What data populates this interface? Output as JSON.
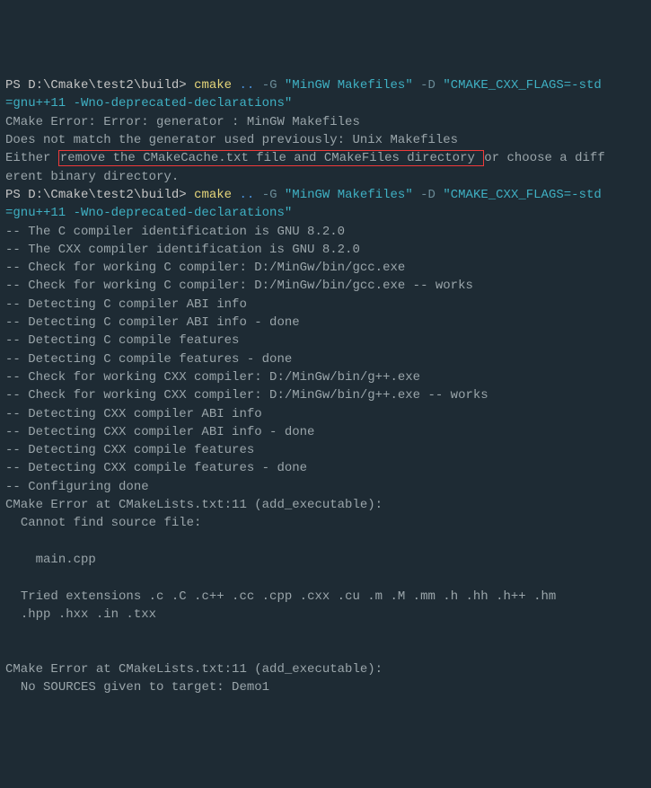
{
  "prompt1": {
    "ps": "PS ",
    "path": "D:\\Cmake\\test2\\build> ",
    "cmd": "cmake ",
    "dots": "..",
    "flag_g": " -G ",
    "gen": "\"MinGW Makefiles\"",
    "flag_d": " -D ",
    "q1": "\"CMAKE_CXX_FLAGS=-std",
    "q2": "=gnu++11 -Wno-deprecated-declarations\""
  },
  "err1": {
    "l1": "CMake Error: Error: generator : MinGW Makefiles",
    "l2": "Does not match the generator used previously: Unix Makefiles",
    "l3a": "Either ",
    "l3b": "remove the CMakeCache.txt file and CMakeFiles directory ",
    "l3c": "or choose a diff",
    "l4": "erent binary directory."
  },
  "prompt2": {
    "ps": "PS ",
    "path": "D:\\Cmake\\test2\\build> ",
    "cmd": "cmake ",
    "dots": "..",
    "flag_g": " -G ",
    "gen": "\"MinGW Makefiles\"",
    "flag_d": " -D ",
    "q1": "\"CMAKE_CXX_FLAGS=-std",
    "q2": "=gnu++11 -Wno-deprecated-declarations\""
  },
  "out": {
    "l1": "-- The C compiler identification is GNU 8.2.0",
    "l2": "-- The CXX compiler identification is GNU 8.2.0",
    "l3": "-- Check for working C compiler: D:/MinGw/bin/gcc.exe",
    "l4": "-- Check for working C compiler: D:/MinGw/bin/gcc.exe -- works",
    "l5": "-- Detecting C compiler ABI info",
    "l6": "-- Detecting C compiler ABI info - done",
    "l7": "-- Detecting C compile features",
    "l8": "-- Detecting C compile features - done",
    "l9": "-- Check for working CXX compiler: D:/MinGw/bin/g++.exe",
    "l10": "-- Check for working CXX compiler: D:/MinGw/bin/g++.exe -- works",
    "l11": "-- Detecting CXX compiler ABI info",
    "l12": "-- Detecting CXX compiler ABI info - done",
    "l13": "-- Detecting CXX compile features",
    "l14": "-- Detecting CXX compile features - done",
    "l15": "-- Configuring done"
  },
  "err2": {
    "l1": "CMake Error at CMakeLists.txt:11 (add_executable):",
    "l2": "  Cannot find source file:",
    "l3": "    main.cpp",
    "l4": "  Tried extensions .c .C .c++ .cc .cpp .cxx .cu .m .M .mm .h .hh .h++ .hm",
    "l5": "  .hpp .hxx .in .txx"
  },
  "err3": {
    "l1": "CMake Error at CMakeLists.txt:11 (add_executable):",
    "l2": "  No SOURCES given to target: Demo1"
  }
}
